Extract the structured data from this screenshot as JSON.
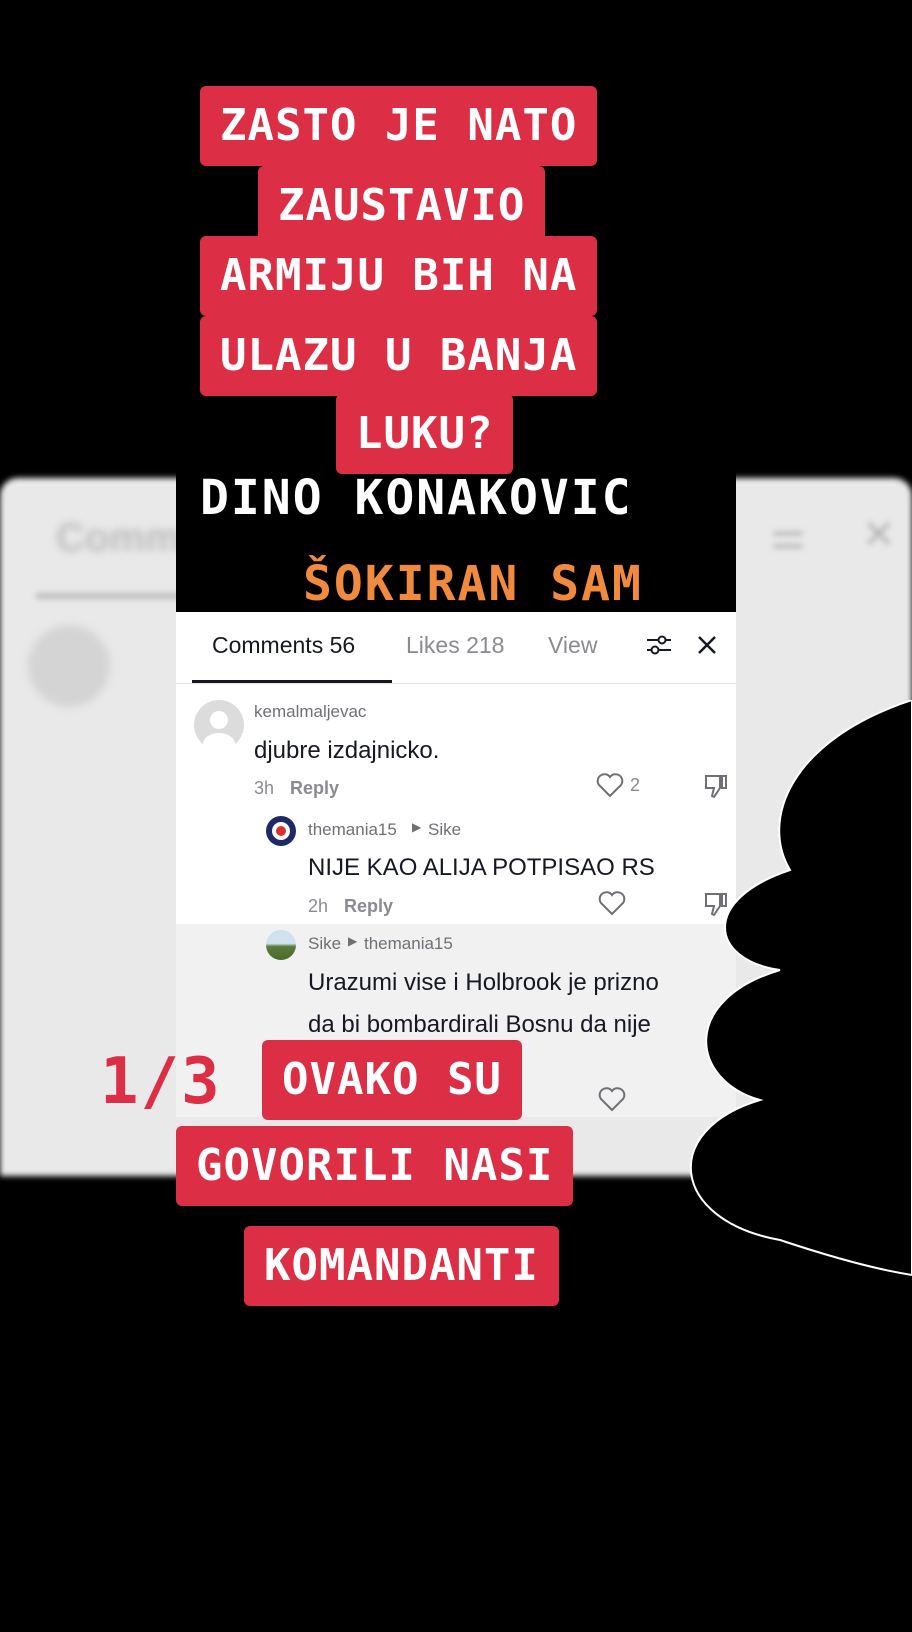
{
  "caption_top": [
    "ZASTO JE NATO",
    "ZAUSTAVIO",
    "ARMIJU BIH NA",
    "ULAZU U BANJA",
    "LUKU?"
  ],
  "video_title": "DINO KONAKOVIC",
  "video_subtitle": "ŠOKIRAN SAM",
  "background_panel": {
    "title": "Comm"
  },
  "tabs": {
    "comments": "Comments 56",
    "likes": "Likes 218",
    "views": "View"
  },
  "comments": [
    {
      "username": "kemalmaljevac",
      "text": "djubre izdajnicko.",
      "time": "3h",
      "reply_label": "Reply",
      "likes": "2"
    },
    {
      "username": "themania15",
      "reply_to": "Sike",
      "text": "NIJE KAO ALIJA POTPISAO RS",
      "time": "2h",
      "reply_label": "Reply"
    },
    {
      "username": "Sike",
      "reply_to": "themania15",
      "text_line1": "Urazumi vise i Holbrook je prizno",
      "text_line2": "da bi bombardirali Bosnu da nije"
    }
  ],
  "page_indicator": "1/3",
  "caption_bottom": [
    "OVAKO SU",
    "GOVORILI NASI",
    "KOMANDANTI"
  ],
  "colors": {
    "caption_bg": "#dc2f45",
    "subtitle": "#f08a3e",
    "accent": "#161823"
  }
}
